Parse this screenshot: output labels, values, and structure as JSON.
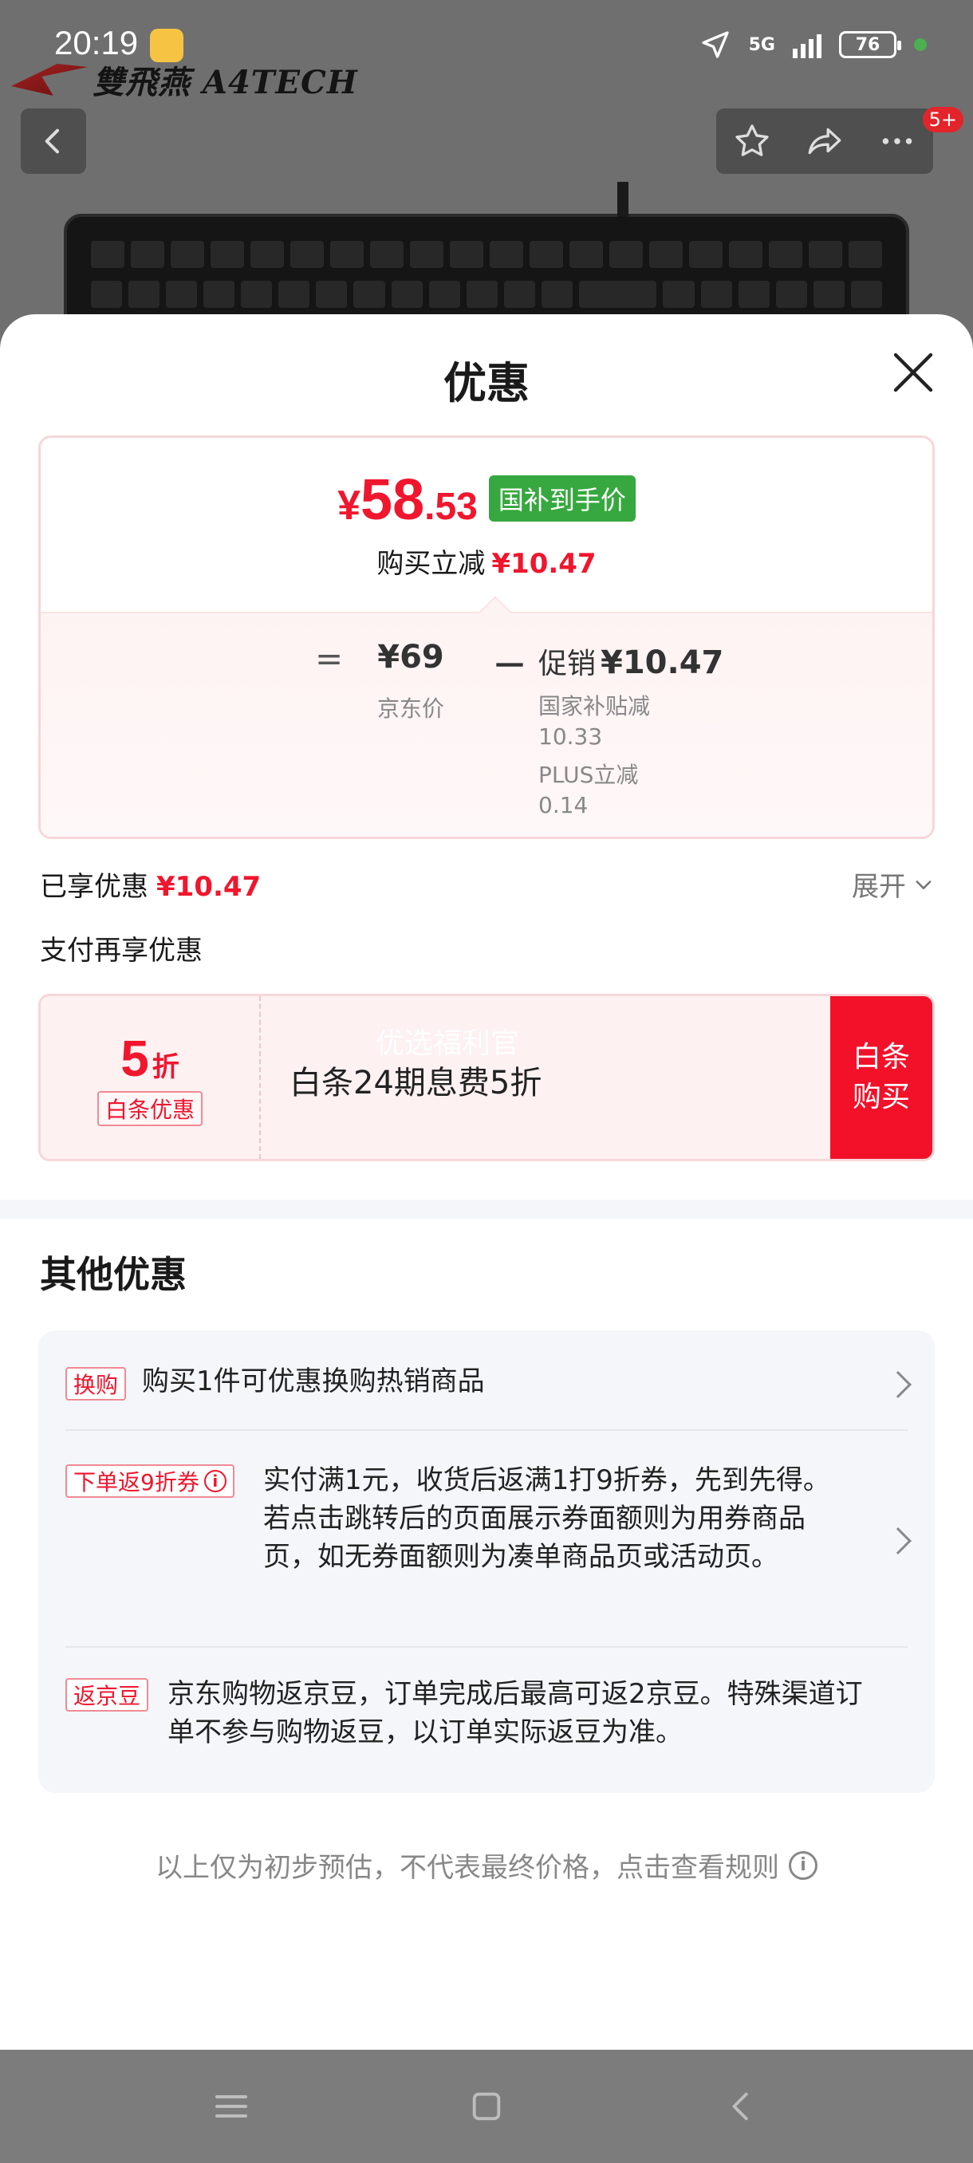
{
  "status_bar": {
    "time": "20:19",
    "network": "5G",
    "battery": "76"
  },
  "brand": {
    "text": "雙飛燕 A4TECH"
  },
  "header": {
    "badge": "5+",
    "icons": [
      "back-icon",
      "star-icon",
      "share-icon",
      "more-icon"
    ]
  },
  "sheet": {
    "title": "优惠",
    "price_card": {
      "symbol": "¥",
      "integer": "58",
      "decimal": ".53",
      "tag": "国补到手价",
      "instant_label": "购买立减",
      "instant_amount": "¥10.47",
      "equals": "=",
      "jd_price": "¥69",
      "jd_label": "京东价",
      "minus": "－",
      "promo_label": "促销",
      "promo_amount": "¥10.47",
      "subsidy_label": "国家补贴减",
      "subsidy_value": "10.33",
      "plus_label": "PLUS立减",
      "plus_value": "0.14"
    },
    "enjoyed_label": "已享优惠",
    "enjoyed_amount": "¥10.47",
    "expand_label": "展开",
    "pay_more_label": "支付再享优惠",
    "coupon": {
      "discount": "5",
      "unit": "折",
      "tag": "白条优惠",
      "watermark": "优选福利官",
      "text": "白条24期息费5折",
      "button": "白条购买"
    },
    "other_title": "其他优惠",
    "offers": [
      {
        "tag": "换购",
        "text": "购买1件可优惠换购热销商品"
      },
      {
        "tag": "下单返9折券",
        "text": "实付满1元，收货后返满1打9折券，先到先得。若点击跳转后的页面展示券面额则为用券商品页，如无券面额则为凑单商品页或活动页。"
      },
      {
        "tag": "返京豆",
        "text": "京东购物返京豆，订单完成后最高可返2京豆。特殊渠道订单不参与购物返豆，以订单实际返豆为准。"
      }
    ],
    "footnote": "以上仅为初步预估，不代表最终价格，点击查看规则"
  },
  "colors": {
    "accent": "#f0162e",
    "tag_green": "#37a83f",
    "overlay": "#6f6f6f"
  }
}
